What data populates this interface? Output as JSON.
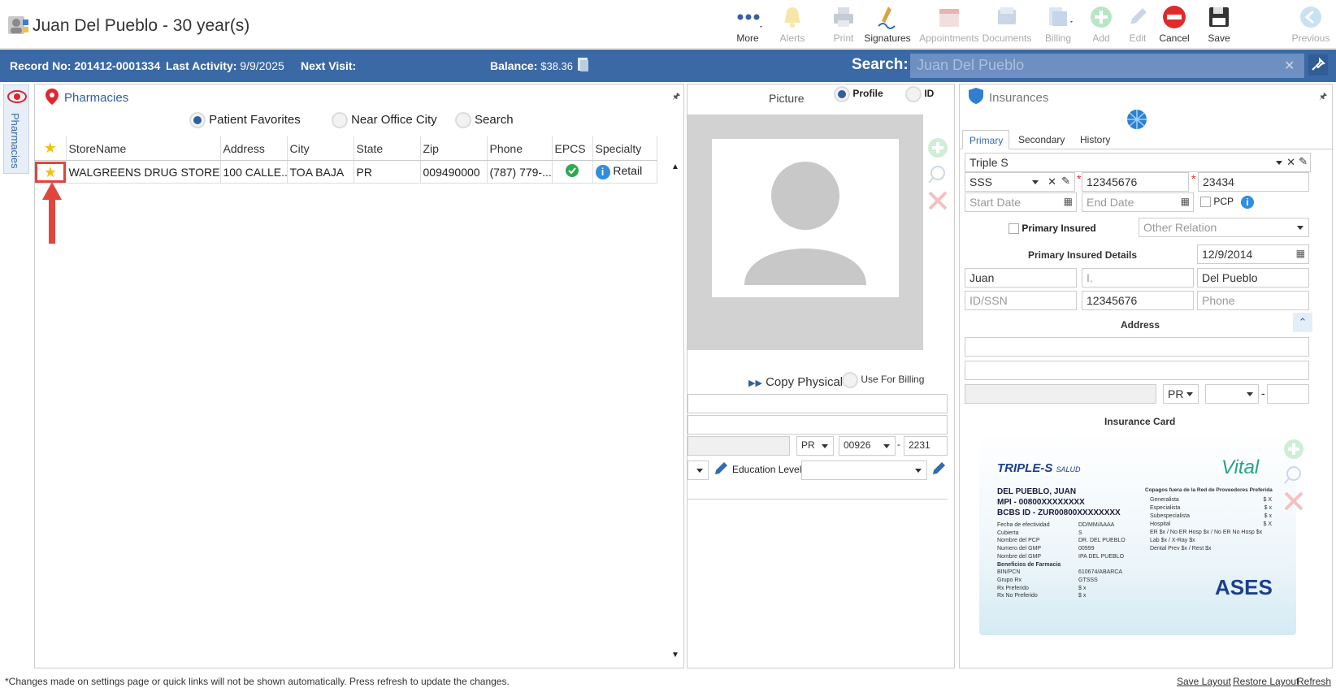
{
  "header": {
    "title": "Juan Del Pueblo - 30 year(s)",
    "toolbar": [
      {
        "label": "More",
        "icon": "more-icon",
        "enabled": true
      },
      {
        "label": "Alerts",
        "icon": "bell-icon",
        "enabled": false
      },
      {
        "label": "Print",
        "icon": "printer-icon",
        "enabled": false
      },
      {
        "label": "Signatures",
        "icon": "signature-icon",
        "enabled": true
      },
      {
        "label": "Appointments",
        "icon": "calendar-icon",
        "enabled": false
      },
      {
        "label": "Documents",
        "icon": "documents-icon",
        "enabled": false
      },
      {
        "label": "Billing",
        "icon": "billing-icon",
        "enabled": false
      },
      {
        "label": "Add",
        "icon": "add-icon",
        "enabled": false
      },
      {
        "label": "Edit",
        "icon": "edit-icon",
        "enabled": false
      },
      {
        "label": "Cancel",
        "icon": "cancel-icon",
        "enabled": true
      },
      {
        "label": "Save",
        "icon": "save-icon",
        "enabled": true
      },
      {
        "label": "Previous",
        "icon": "previous-icon",
        "enabled": false
      }
    ]
  },
  "infobar": {
    "record_label": "Record No:",
    "record_value": "201412-0001334",
    "activity_label": "Last Activity:",
    "activity_value": "9/9/2025",
    "next_visit_label": "Next Visit:",
    "balance_label": "Balance:",
    "balance_value": "$38.36",
    "search_label": "Search:",
    "search_value": "Juan Del Pueblo"
  },
  "side_tab": {
    "label": "Pharmacies"
  },
  "pharmacies": {
    "title": "Pharmacies",
    "filters": [
      {
        "label": "Patient Favorites",
        "selected": true
      },
      {
        "label": "Near Office City",
        "selected": false
      },
      {
        "label": "Search",
        "selected": false
      }
    ],
    "columns": [
      "StoreName",
      "Address",
      "City",
      "State",
      "Zip",
      "Phone",
      "EPCS",
      "Specialty"
    ],
    "rows": [
      {
        "store": "WALGREENS DRUG STORE #...",
        "address": "100 CALLE...",
        "city": "TOA BAJA",
        "state": "PR",
        "zip": "009490000",
        "phone": "(787) 779-...",
        "epcs": "check",
        "specialty": "Retail"
      }
    ]
  },
  "picture": {
    "title": "Picture",
    "options": [
      {
        "label": "Profile",
        "selected": true
      },
      {
        "label": "ID",
        "selected": false
      }
    ],
    "copy_physical": "Copy Physical",
    "use_for_billing": "Use For Billing",
    "state": "PR",
    "zip": "00926",
    "zip_ext": "2231",
    "education_label": "Education Level:"
  },
  "insurances": {
    "title": "Insurances",
    "tabs": [
      "Primary",
      "Secondary",
      "History"
    ],
    "plan": "Triple S",
    "coverage": "SSS",
    "policy": "12345676",
    "group": "23434",
    "start_placeholder": "Start Date",
    "end_placeholder": "End Date",
    "pcp_label": "PCP",
    "primary_insured_label": "Primary Insured",
    "other_relation_placeholder": "Other Relation",
    "details_label": "Primary Insured Details",
    "dob": "12/9/2014",
    "first_name": "Juan",
    "middle": "I.",
    "last_name": "Del Pueblo",
    "idssn_placeholder": "ID/SSN",
    "member_id": "12345676",
    "phone_placeholder": "Phone",
    "address_label": "Address",
    "state": "PR",
    "card_label": "Insurance Card",
    "card": {
      "brand": "TRIPLE-S",
      "brand_sub": "SALUD",
      "partner": "Vital",
      "name": "DEL PUEBLO, JUAN",
      "mpi": "MPI - 00800XXXXXXXX",
      "bcbs": "BCBS ID - ZUR00800XXXXXXXX",
      "left_rows": [
        [
          "Fecha de efectividad",
          "DD/MM/AAAA"
        ],
        [
          "Cubierta",
          "S"
        ],
        [
          "Nombre del PCP",
          "DR. DEL PUEBLO"
        ],
        [
          "Numero del GMP",
          "00999"
        ],
        [
          "Nombre del GMP",
          "IPA DEL PUEBLO"
        ],
        [
          "Beneficios de Farmacia",
          ""
        ],
        [
          "BIN/PCN",
          "610674/ABARCA"
        ],
        [
          "Grupo Rx",
          "GTSSS"
        ],
        [
          "Rx Preferido",
          "$ x"
        ],
        [
          "Rx No Preferido",
          "$ x"
        ]
      ],
      "right_title": "Copagos fuera de la Red de Proveedores Preferida",
      "right_rows": [
        [
          "Generalista",
          "$ X"
        ],
        [
          "Especialista",
          "$ x"
        ],
        [
          "Subespecialista",
          "$ x"
        ],
        [
          "Hospital",
          "$ X"
        ],
        [
          "ER $x / No ER Hosp $x / No ER No Hosp $x",
          ""
        ],
        [
          "Lab $x / X-Ray $x",
          ""
        ],
        [
          "Dental Prev $x / Rest $x",
          ""
        ]
      ],
      "footer_logo": "ASES"
    }
  },
  "footer": {
    "note": "*Changes made on settings page or quick links will not be shown automatically. Press refresh to update the changes.",
    "links": [
      "Save Layout",
      "Restore Layout",
      "Refresh"
    ]
  }
}
